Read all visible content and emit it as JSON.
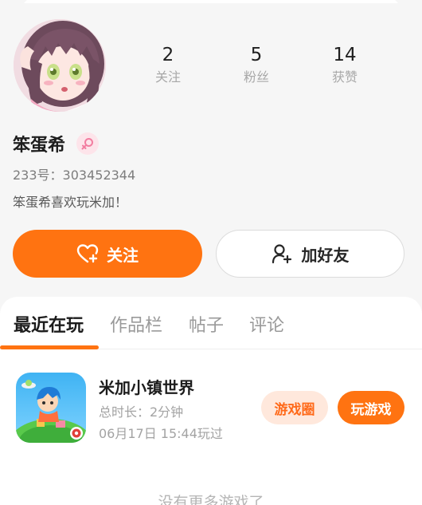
{
  "profile": {
    "username": "笨蛋希",
    "gender_icon": "female-icon",
    "uid_text": "233号：303452344",
    "bio": "笨蛋希喜欢玩米加！"
  },
  "stats": [
    {
      "value": "2",
      "label": "关注"
    },
    {
      "value": "5",
      "label": "粉丝"
    },
    {
      "value": "14",
      "label": "获赞"
    }
  ],
  "actions": {
    "follow_label": "关注",
    "follow_icon": "heart-plus-icon",
    "add_friend_label": "加好友",
    "add_friend_icon": "user-plus-icon"
  },
  "tabs": [
    {
      "label": "最近在玩",
      "active": true
    },
    {
      "label": "作品栏",
      "active": false
    },
    {
      "label": "帖子",
      "active": false
    },
    {
      "label": "评论",
      "active": false
    }
  ],
  "recent_game": {
    "title": "米加小镇世界",
    "duration": "总时长：2分钟",
    "last_played": "06月17日 15:44玩过",
    "circle_label": "游戏圈",
    "play_label": "玩游戏"
  },
  "footer_text": "没有更多游戏了",
  "colors": {
    "accent": "#ff7311",
    "accent_light": "#ffe8dc",
    "background": "#f6f6f6",
    "female_badge": "#fde4ea"
  }
}
